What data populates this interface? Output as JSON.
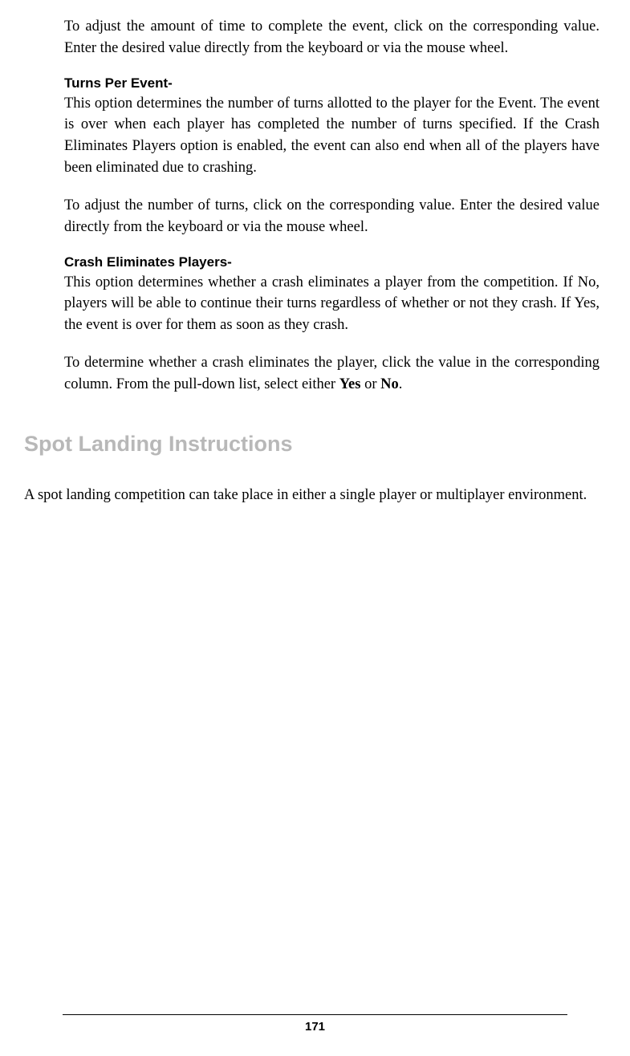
{
  "paragraphs": {
    "p1": "To adjust the amount of time to complete the event, click on the corresponding value.  Enter the desired value directly from the keyboard or via the mouse wheel.",
    "sub_heading_1": "Turns Per Event-",
    "p2": "This option determines the number of turns allotted to the player for the Event.  The event is over when each player has completed the number of turns specified.  If the Crash Eliminates Players option is enabled, the event can also end when all of the players have been eliminated due to crashing.",
    "p3": "To adjust the number of turns, click on the corresponding value.  Enter the desired value directly from the keyboard or via the mouse wheel.",
    "sub_heading_2": "Crash Eliminates Players-",
    "p4": "This option determines whether a crash eliminates a player from the competition.  If No, players will be able to continue their turns regardless of whether or not they crash.  If Yes, the event is over for them as soon as they crash.",
    "p5_part1": "To determine whether a crash eliminates the player, click the value in the corresponding column.  From the pull-down list, select either ",
    "p5_yes": "Yes",
    "p5_or": " or ",
    "p5_no": "No",
    "p5_end": "."
  },
  "section_heading": "Spot Landing Instructions",
  "intro": "A spot landing competition can take place in either a single player or multiplayer environment.",
  "page_number": "171"
}
